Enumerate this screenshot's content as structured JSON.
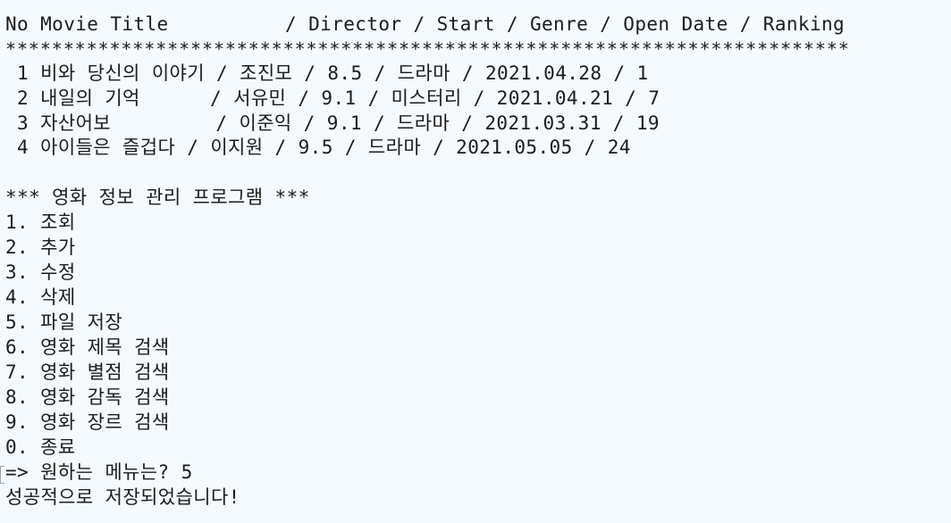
{
  "terminal": {
    "header": "No Movie Title          / Director / Start / Genre / Open Date / Ranking",
    "separator": "*************************************************************************",
    "rows": [
      " 1 비와 당신의 이야기 / 조진모 / 8.5 / 드라마 / 2021.04.28 / 1",
      " 2 내일의 기억      / 서유민 / 9.1 / 미스터리 / 2021.04.21 / 7",
      " 3 자산어보         / 이준익 / 9.1 / 드라마 / 2021.03.31 / 19",
      " 4 아이들은 즐겁다 / 이지원 / 9.5 / 드라마 / 2021.05.05 / 24"
    ],
    "menu_title": "*** 영화 정보 관리 프로그램 ***",
    "menu_items": [
      "1. 조회",
      "2. 추가",
      "3. 수정",
      "4. 삭제",
      "5. 파일 저장",
      "6. 영화 제목 검색",
      "7. 영화 별점 검색",
      "8. 영화 감독 검색",
      "9. 영화 장르 검색",
      "0. 종료"
    ],
    "prompt": "=> 원하는 메뉴는? 5",
    "result": "성공적으로 저장되었습니다!",
    "colors": {
      "background": "#f4f9fd",
      "text": "#1b1b1b"
    }
  }
}
